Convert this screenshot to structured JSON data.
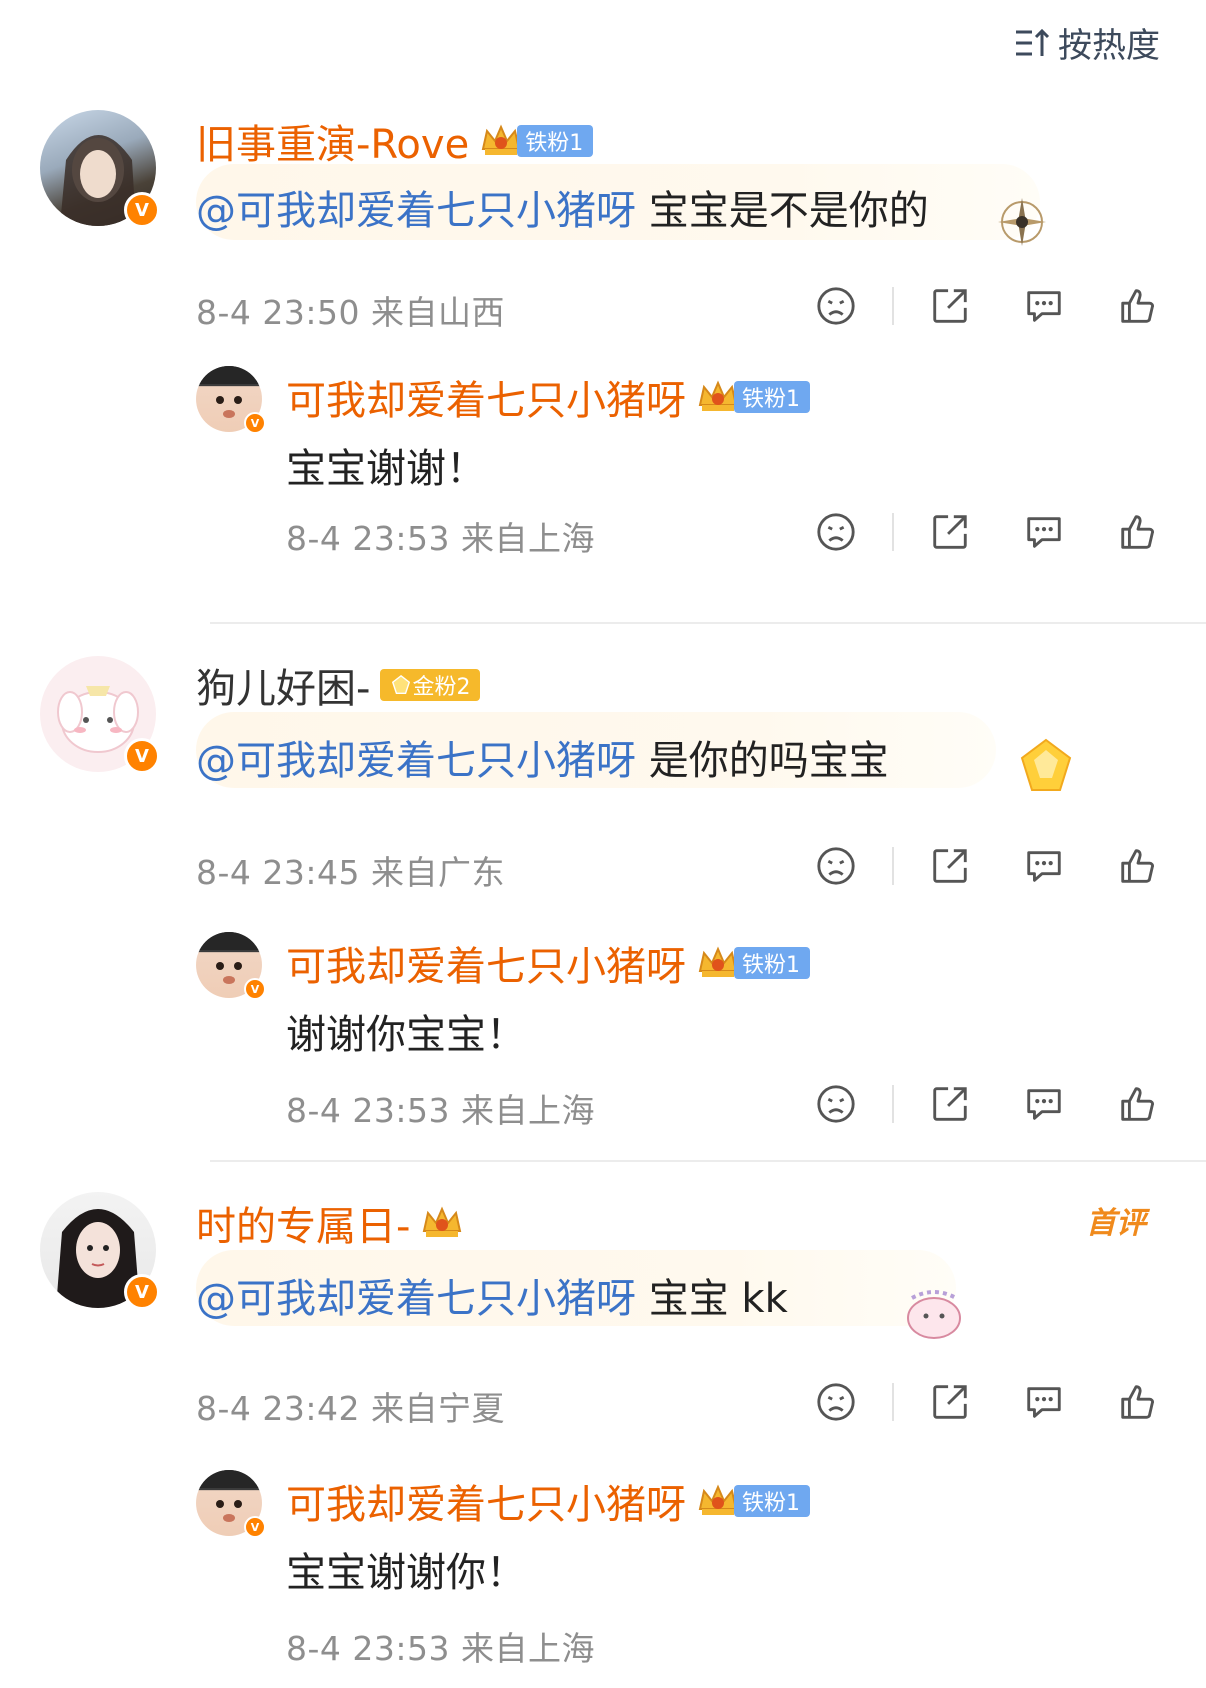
{
  "header": {
    "sort_label": "按热度",
    "sort_icon": "sort-icon"
  },
  "threads": [
    {
      "user": "旧事重演-Rove",
      "fan_badge": "铁粉1",
      "mention": "@可我却爱着七只小猪呀",
      "text": "宝宝是不是你的",
      "time": "8-4 23:50",
      "location": "来自山西",
      "reply": {
        "user": "可我却爱着七只小猪呀",
        "fan_badge": "铁粉1",
        "text": "宝宝谢谢！",
        "time": "8-4 23:53",
        "location": "来自上海"
      }
    },
    {
      "user": "狗儿好困-",
      "fan_badge": "金粉2",
      "mention": "@可我却爱着七只小猪呀",
      "text": "是你的吗宝宝",
      "time": "8-4 23:45",
      "location": "来自广东",
      "reply": {
        "user": "可我却爱着七只小猪呀",
        "fan_badge": "铁粉1",
        "text": "谢谢你宝宝！",
        "time": "8-4 23:53",
        "location": "来自上海"
      }
    },
    {
      "user": "时的专属日-",
      "first_tag": "首评",
      "mention": "@可我却爱着七只小猪呀",
      "text": "宝宝 kk",
      "time": "8-4 23:42",
      "location": "来自宁夏",
      "reply": {
        "user": "可我却爱着七只小猪呀",
        "fan_badge": "铁粉1",
        "text": "宝宝谢谢你！",
        "time": "8-4 23:53",
        "location": "来自上海"
      }
    }
  ],
  "colors": {
    "username": "#eb6100",
    "mention": "#3b73c7",
    "verified": "#ff8200",
    "iron_badge": "#6fa8f0",
    "gold_badge": "#f6b92b"
  }
}
